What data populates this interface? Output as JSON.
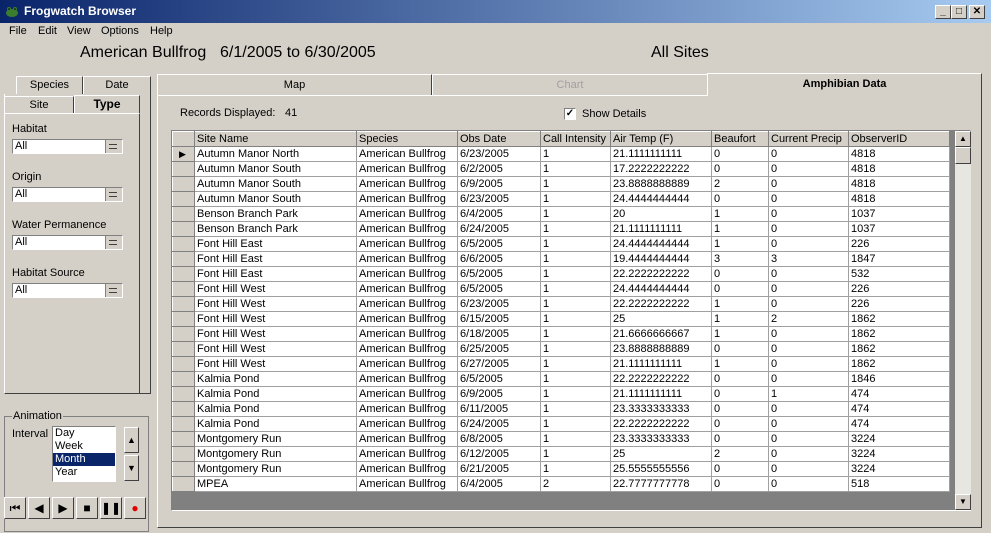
{
  "window": {
    "title": "Frogwatch Browser",
    "minimize": "_",
    "maximize": "□",
    "close": "✕"
  },
  "menu": [
    "File",
    "Edit",
    "View",
    "Options",
    "Help"
  ],
  "header": {
    "species": "American Bullfrog",
    "daterange": "6/1/2005 to 6/30/2005",
    "sites": "All Sites"
  },
  "left_tabs": {
    "species": "Species",
    "date": "Date",
    "site": "Site",
    "type": "Type"
  },
  "filters": [
    {
      "label": "Habitat",
      "value": "All"
    },
    {
      "label": "Origin",
      "value": "All"
    },
    {
      "label": "Water Permanence",
      "value": "All"
    },
    {
      "label": "Habitat Source",
      "value": "All"
    }
  ],
  "animation": {
    "group": "Animation",
    "interval_label": "Interval",
    "options": [
      "Day",
      "Week",
      "Month",
      "Year"
    ],
    "selected": "Month"
  },
  "main_tabs": {
    "map": "Map",
    "chart": "Chart",
    "data": "Amphibian Data"
  },
  "records": {
    "label": "Records Displayed:",
    "count": "41"
  },
  "show_details": {
    "label": "Show Details",
    "checked": true
  },
  "table": {
    "columns": [
      "Site Name",
      "Species",
      "Obs Date",
      "Call Intensity",
      "Air Temp (F)",
      "Beaufort",
      "Current Precip",
      "ObserverID"
    ],
    "rows": [
      [
        "Autumn Manor North",
        "American Bullfrog",
        "6/23/2005",
        "1",
        "21.1111111111",
        "0",
        "0",
        "4818"
      ],
      [
        "Autumn Manor South",
        "American Bullfrog",
        "6/2/2005",
        "1",
        "17.2222222222",
        "0",
        "0",
        "4818"
      ],
      [
        "Autumn Manor South",
        "American Bullfrog",
        "6/9/2005",
        "1",
        "23.8888888889",
        "2",
        "0",
        "4818"
      ],
      [
        "Autumn Manor South",
        "American Bullfrog",
        "6/23/2005",
        "1",
        "24.4444444444",
        "0",
        "0",
        "4818"
      ],
      [
        "Benson Branch Park",
        "American Bullfrog",
        "6/4/2005",
        "1",
        "20",
        "1",
        "0",
        "1037"
      ],
      [
        "Benson Branch Park",
        "American Bullfrog",
        "6/24/2005",
        "1",
        "21.1111111111",
        "1",
        "0",
        "1037"
      ],
      [
        "Font Hill East",
        "American Bullfrog",
        "6/5/2005",
        "1",
        "24.4444444444",
        "1",
        "0",
        "226"
      ],
      [
        "Font Hill East",
        "American Bullfrog",
        "6/6/2005",
        "1",
        "19.4444444444",
        "3",
        "3",
        "1847"
      ],
      [
        "Font Hill East",
        "American Bullfrog",
        "6/5/2005",
        "1",
        "22.2222222222",
        "0",
        "0",
        "532"
      ],
      [
        "Font Hill West",
        "American Bullfrog",
        "6/5/2005",
        "1",
        "24.4444444444",
        "0",
        "0",
        "226"
      ],
      [
        "Font Hill West",
        "American Bullfrog",
        "6/23/2005",
        "1",
        "22.2222222222",
        "1",
        "0",
        "226"
      ],
      [
        "Font Hill West",
        "American Bullfrog",
        "6/15/2005",
        "1",
        "25",
        "1",
        "2",
        "1862"
      ],
      [
        "Font Hill West",
        "American Bullfrog",
        "6/18/2005",
        "1",
        "21.6666666667",
        "1",
        "0",
        "1862"
      ],
      [
        "Font Hill West",
        "American Bullfrog",
        "6/25/2005",
        "1",
        "23.8888888889",
        "0",
        "0",
        "1862"
      ],
      [
        "Font Hill West",
        "American Bullfrog",
        "6/27/2005",
        "1",
        "21.1111111111",
        "1",
        "0",
        "1862"
      ],
      [
        "Kalmia Pond",
        "American Bullfrog",
        "6/5/2005",
        "1",
        "22.2222222222",
        "0",
        "0",
        "1846"
      ],
      [
        "Kalmia Pond",
        "American Bullfrog",
        "6/9/2005",
        "1",
        "21.1111111111",
        "0",
        "1",
        "474"
      ],
      [
        "Kalmia Pond",
        "American Bullfrog",
        "6/11/2005",
        "1",
        "23.3333333333",
        "0",
        "0",
        "474"
      ],
      [
        "Kalmia Pond",
        "American Bullfrog",
        "6/24/2005",
        "1",
        "22.2222222222",
        "0",
        "0",
        "474"
      ],
      [
        "Montgomery Run",
        "American Bullfrog",
        "6/8/2005",
        "1",
        "23.3333333333",
        "0",
        "0",
        "3224"
      ],
      [
        "Montgomery Run",
        "American Bullfrog",
        "6/12/2005",
        "1",
        "25",
        "2",
        "0",
        "3224"
      ],
      [
        "Montgomery Run",
        "American Bullfrog",
        "6/21/2005",
        "1",
        "25.5555555556",
        "0",
        "0",
        "3224"
      ],
      [
        "MPEA",
        "American Bullfrog",
        "6/4/2005",
        "2",
        "22.7777777778",
        "0",
        "0",
        "518"
      ]
    ]
  },
  "icons": {
    "app": "frog-icon",
    "row_pointer": "▶",
    "scroll_up": "▲",
    "scroll_down": "▼",
    "media": [
      "⏮",
      "◀",
      "▶",
      "■",
      "❚❚",
      "●"
    ]
  }
}
